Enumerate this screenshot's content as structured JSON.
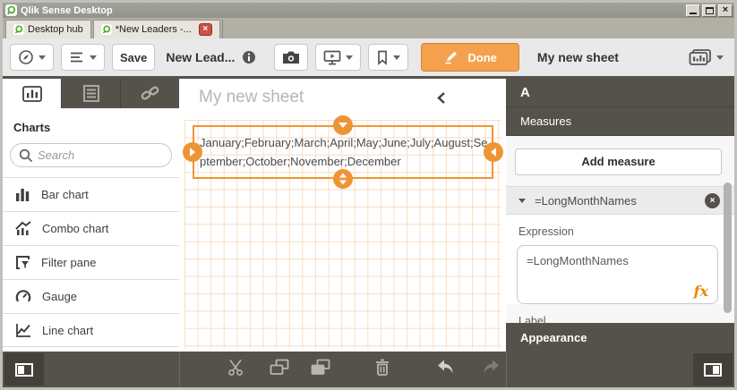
{
  "window": {
    "title": "Qlik Sense Desktop",
    "tabs": [
      {
        "label": "Desktop hub"
      },
      {
        "label": "*New Leaders -..."
      }
    ]
  },
  "glyphs": {
    "close": "×"
  },
  "toolbar": {
    "save_label": "Save",
    "app_title": "New Lead...",
    "done_label": "Done",
    "sheet_name": "My new sheet"
  },
  "left_panel": {
    "heading": "Charts",
    "search_placeholder": "Search",
    "items": [
      {
        "label": "Bar chart"
      },
      {
        "label": "Combo chart"
      },
      {
        "label": "Filter pane"
      },
      {
        "label": "Gauge"
      },
      {
        "label": "Line chart"
      }
    ]
  },
  "canvas": {
    "sheet_title": "My new sheet",
    "textbox_line1": "January;February;March;April;May;June;July;August;Se",
    "textbox_line2": "ptember;October;November;December"
  },
  "right_panel": {
    "header": "A",
    "measures_section": "Measures",
    "add_measure_label": "Add measure",
    "measure_name": "=LongMonthNames",
    "expression_label": "Expression",
    "expression_value": "=LongMonthNames",
    "fx_label": "fx",
    "label_label": "Label",
    "appearance_section": "Appearance"
  },
  "colors": {
    "accent_orange": "#EF9434",
    "done_button": "#F5A04D",
    "qlik_green": "#54A932",
    "chrome_dark": "#55524C",
    "grid_line": "#F9DDC1"
  }
}
